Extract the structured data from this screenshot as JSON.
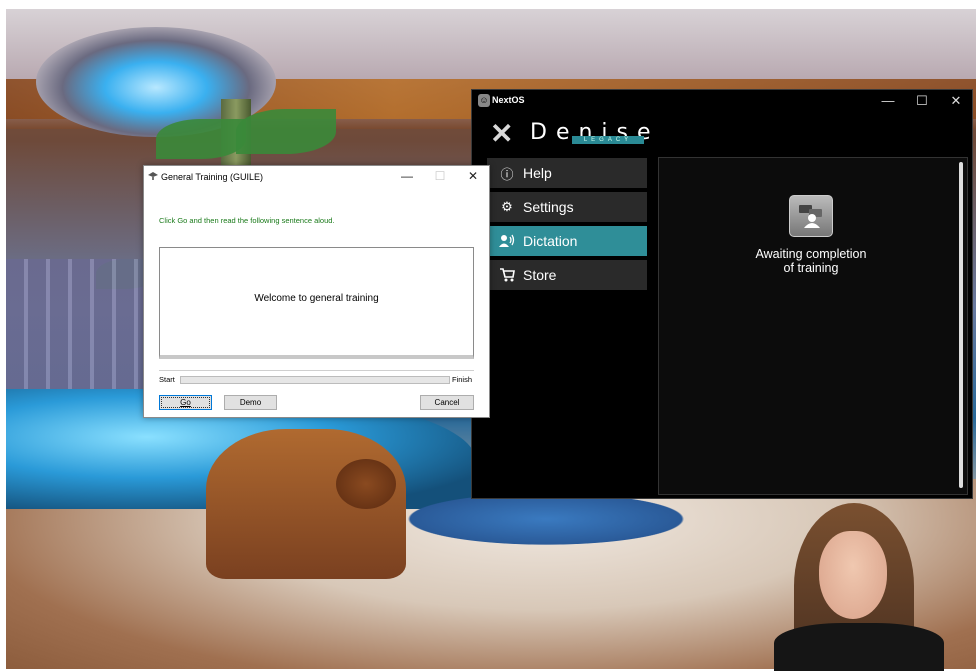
{
  "nextos": {
    "title": "NextOS",
    "controls": {
      "minimize": "—",
      "maximize": "☐",
      "close": "✕"
    },
    "logo": {
      "mark": "✕",
      "word": "Denise",
      "sub": "LEGACY"
    },
    "menu": [
      {
        "label": "Help",
        "icon": "info-icon",
        "glyph": "ⓘ"
      },
      {
        "label": "Settings",
        "icon": "gear-icon",
        "glyph": "⚙"
      },
      {
        "label": "Dictation",
        "icon": "speaking-person-icon",
        "glyph": "🗣",
        "active": true
      },
      {
        "label": "Store",
        "icon": "cart-icon",
        "glyph": "🛒"
      }
    ],
    "status_line1": "Awaiting completion",
    "status_line2": "of training",
    "accent_color": "#2f8e98"
  },
  "dialog": {
    "title": "General Training (GUILE)",
    "controls": {
      "minimize": "—",
      "maximize": "☐",
      "close": "✕"
    },
    "instruction": "Click Go and then read the following sentence aloud.",
    "sentence": "Welcome to general training",
    "progress_start": "Start",
    "progress_finish": "Finish",
    "progress_value": 0,
    "buttons": {
      "go": "Go",
      "demo": "Demo",
      "cancel": "Cancel"
    }
  }
}
